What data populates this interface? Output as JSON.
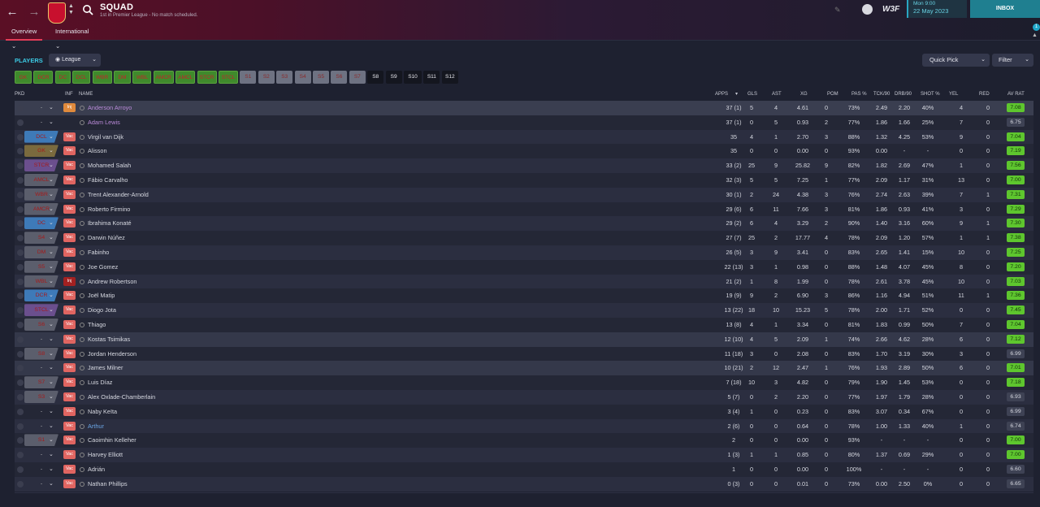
{
  "header": {
    "title": "SQUAD",
    "subtitle": "1st in Premier League - No match scheduled.",
    "tabs": [
      "Overview",
      "International"
    ],
    "date_day": "Mon 9:00",
    "date": "22 May 2023",
    "inbox": "INBOX",
    "notifications": "1",
    "brand": "W3F"
  },
  "toolbar": {
    "players": "PLAYERS",
    "league": "League",
    "quick_pick": "Quick Pick",
    "filter": "Filter"
  },
  "chips": [
    "GK",
    "DCR",
    "DC",
    "DCL",
    "WBR",
    "DM",
    "WBL",
    "AMCR",
    "AMCL",
    "STCR",
    "STCL",
    "S1",
    "S2",
    "S3",
    "S4",
    "S5",
    "S6",
    "S7",
    "S8",
    "S9",
    "S10",
    "S11",
    "S12"
  ],
  "columns": [
    "PKD",
    "INF",
    "NAME",
    "APPS",
    "GLS",
    "AST",
    "XG",
    "POM",
    "PAS %",
    "TCK/90",
    "DRB/90",
    "SHOT %",
    "YEL",
    "RED",
    "AV RAT"
  ],
  "colors": {
    "accent": "#3ccbe5",
    "inbox": "#1f7f90",
    "chip_green": "#3f8a2c",
    "rating_green": "#5ec62e",
    "vac": "#e06561",
    "inj": "#a32121",
    "tbd": "#e08a3c"
  },
  "players": [
    {
      "pos": "-",
      "inf": "Inj",
      "name": "Anderson Arroyo",
      "apps": "37 (1)",
      "gls": "5",
      "ast": "4",
      "xg": "4.61",
      "pom": "0",
      "pas": "73%",
      "tck": "2.49",
      "drb": "2.20",
      "shot": "40%",
      "yel": "4",
      "red": "0",
      "avr": "7.08",
      "name_color": "#b98ad8",
      "inf_type": "tbd"
    },
    {
      "pos": "-",
      "inf": "",
      "name": "Adam Lewis",
      "apps": "37 (1)",
      "gls": "0",
      "ast": "5",
      "xg": "0.93",
      "pom": "2",
      "pas": "77%",
      "tck": "1.86",
      "drb": "1.66",
      "shot": "25%",
      "yel": "7",
      "red": "0",
      "avr": "6.75",
      "name_color": "#b98ad8",
      "inf_type": "none"
    },
    {
      "pos": "DCL",
      "inf": "Vac",
      "name": "Virgil van Dijk",
      "apps": "35",
      "gls": "4",
      "ast": "1",
      "xg": "2.70",
      "pom": "3",
      "pas": "88%",
      "tck": "1.32",
      "drb": "4.25",
      "shot": "53%",
      "yel": "9",
      "red": "0",
      "avr": "7.04",
      "inf_type": "vac",
      "pos_color": "#3e7ab8"
    },
    {
      "pos": "GK",
      "inf": "Vac",
      "name": "Alisson",
      "apps": "35",
      "gls": "0",
      "ast": "0",
      "xg": "0.00",
      "pom": "0",
      "pas": "93%",
      "tck": "0.00",
      "drb": "-",
      "shot": "-",
      "yel": "0",
      "red": "0",
      "avr": "7.19",
      "inf_type": "vac",
      "pos_color": "#7a6a3e"
    },
    {
      "pos": "STCR",
      "inf": "Vac",
      "name": "Mohamed Salah",
      "apps": "33 (2)",
      "gls": "25",
      "ast": "9",
      "xg": "25.82",
      "pom": "9",
      "pas": "82%",
      "tck": "1.82",
      "drb": "2.69",
      "shot": "47%",
      "yel": "1",
      "red": "0",
      "avr": "7.56",
      "inf_type": "vac",
      "pos_color": "#6b4f8e"
    },
    {
      "pos": "AMCL",
      "inf": "Vac",
      "name": "Fábio Carvalho",
      "apps": "32 (3)",
      "gls": "5",
      "ast": "5",
      "xg": "7.25",
      "pom": "1",
      "pas": "77%",
      "tck": "2.09",
      "drb": "1.17",
      "shot": "31%",
      "yel": "13",
      "red": "0",
      "avr": "7.00",
      "inf_type": "vac",
      "pos_color": "#5b5e6c"
    },
    {
      "pos": "WBR",
      "inf": "Vac",
      "name": "Trent Alexander-Arnold",
      "apps": "30 (1)",
      "gls": "2",
      "ast": "24",
      "xg": "4.38",
      "pom": "3",
      "pas": "76%",
      "tck": "2.74",
      "drb": "2.63",
      "shot": "39%",
      "yel": "7",
      "red": "1",
      "avr": "7.31",
      "inf_type": "vac",
      "pos_color": "#5b5e6c"
    },
    {
      "pos": "AMCR",
      "inf": "Vac",
      "name": "Roberto Firmino",
      "apps": "29 (6)",
      "gls": "6",
      "ast": "11",
      "xg": "7.66",
      "pom": "3",
      "pas": "81%",
      "tck": "1.86",
      "drb": "0.93",
      "shot": "41%",
      "yel": "3",
      "red": "0",
      "avr": "7.29",
      "inf_type": "vac",
      "pos_color": "#5b5e6c"
    },
    {
      "pos": "DC",
      "inf": "Vac",
      "name": "Ibrahima Konaté",
      "apps": "29 (2)",
      "gls": "6",
      "ast": "4",
      "xg": "3.29",
      "pom": "2",
      "pas": "90%",
      "tck": "1.40",
      "drb": "3.16",
      "shot": "60%",
      "yel": "9",
      "red": "1",
      "avr": "7.30",
      "inf_type": "vac",
      "pos_color": "#3e7ab8"
    },
    {
      "pos": "S4",
      "inf": "Vac",
      "name": "Darwin Núñez",
      "apps": "27 (7)",
      "gls": "25",
      "ast": "2",
      "xg": "17.77",
      "pom": "4",
      "pas": "78%",
      "tck": "2.09",
      "drb": "1.20",
      "shot": "57%",
      "yel": "1",
      "red": "1",
      "avr": "7.38",
      "inf_type": "vac",
      "pos_color": "#5b5e6c"
    },
    {
      "pos": "DM",
      "inf": "Vac",
      "name": "Fabinho",
      "apps": "26 (5)",
      "gls": "3",
      "ast": "9",
      "xg": "3.41",
      "pom": "0",
      "pas": "83%",
      "tck": "2.65",
      "drb": "1.41",
      "shot": "15%",
      "yel": "10",
      "red": "0",
      "avr": "7.25",
      "inf_type": "vac",
      "pos_color": "#5b5e6c"
    },
    {
      "pos": "S5",
      "inf": "Vac",
      "name": "Joe Gomez",
      "apps": "22 (13)",
      "gls": "3",
      "ast": "1",
      "xg": "0.98",
      "pom": "0",
      "pas": "88%",
      "tck": "1.48",
      "drb": "4.07",
      "shot": "45%",
      "yel": "8",
      "red": "0",
      "avr": "7.20",
      "inf_type": "vac",
      "pos_color": "#5b5e6c"
    },
    {
      "pos": "WBL",
      "inf": "Inj",
      "name": "Andrew Robertson",
      "apps": "21 (2)",
      "gls": "1",
      "ast": "8",
      "xg": "1.99",
      "pom": "0",
      "pas": "78%",
      "tck": "2.61",
      "drb": "3.78",
      "shot": "45%",
      "yel": "10",
      "red": "0",
      "avr": "7.03",
      "inf_type": "inj",
      "pos_color": "#5b5e6c"
    },
    {
      "pos": "DCR",
      "inf": "Vac",
      "name": "Joël Matip",
      "apps": "19 (9)",
      "gls": "9",
      "ast": "2",
      "xg": "6.90",
      "pom": "3",
      "pas": "86%",
      "tck": "1.16",
      "drb": "4.94",
      "shot": "51%",
      "yel": "11",
      "red": "1",
      "avr": "7.36",
      "inf_type": "vac",
      "pos_color": "#3e7ab8"
    },
    {
      "pos": "STCL",
      "inf": "Vac",
      "name": "Diogo Jota",
      "apps": "13 (22)",
      "gls": "18",
      "ast": "10",
      "xg": "15.23",
      "pom": "5",
      "pas": "78%",
      "tck": "2.00",
      "drb": "1.71",
      "shot": "52%",
      "yel": "0",
      "red": "0",
      "avr": "7.45",
      "inf_type": "vac",
      "pos_color": "#6b4f8e"
    },
    {
      "pos": "S6",
      "inf": "Vac",
      "name": "Thiago",
      "apps": "13 (8)",
      "gls": "4",
      "ast": "1",
      "xg": "3.34",
      "pom": "0",
      "pas": "81%",
      "tck": "1.83",
      "drb": "0.99",
      "shot": "50%",
      "yel": "7",
      "red": "0",
      "avr": "7.04",
      "inf_type": "vac",
      "pos_color": "#5b5e6c"
    },
    {
      "pos": "-",
      "inf": "Vac",
      "name": "Kostas Tsimikas",
      "apps": "12 (10)",
      "gls": "4",
      "ast": "5",
      "xg": "2.09",
      "pom": "1",
      "pas": "74%",
      "tck": "2.66",
      "drb": "4.62",
      "shot": "28%",
      "yel": "6",
      "red": "0",
      "avr": "7.12",
      "inf_type": "vac",
      "pos_color": "#5b5e6c"
    },
    {
      "pos": "S8",
      "inf": "Vac",
      "name": "Jordan Henderson",
      "apps": "11 (18)",
      "gls": "3",
      "ast": "0",
      "xg": "2.08",
      "pom": "0",
      "pas": "83%",
      "tck": "1.70",
      "drb": "3.19",
      "shot": "30%",
      "yel": "3",
      "red": "0",
      "avr": "6.99",
      "inf_type": "vac",
      "pos_color": "#5b5e6c"
    },
    {
      "pos": "-",
      "inf": "Vac",
      "name": "James Milner",
      "apps": "10 (21)",
      "gls": "2",
      "ast": "12",
      "xg": "2.47",
      "pom": "1",
      "pas": "76%",
      "tck": "1.93",
      "drb": "2.89",
      "shot": "50%",
      "yel": "6",
      "red": "0",
      "avr": "7.01",
      "inf_type": "vac",
      "pos_color": "#5b5e6c"
    },
    {
      "pos": "S7",
      "inf": "Vac",
      "name": "Luis Díaz",
      "apps": "7 (18)",
      "gls": "10",
      "ast": "3",
      "xg": "4.82",
      "pom": "0",
      "pas": "79%",
      "tck": "1.90",
      "drb": "1.45",
      "shot": "53%",
      "yel": "0",
      "red": "0",
      "avr": "7.18",
      "inf_type": "vac",
      "pos_color": "#5b5e6c"
    },
    {
      "pos": "S3",
      "inf": "Vac",
      "name": "Alex Oxlade-Chamberlain",
      "apps": "5 (7)",
      "gls": "0",
      "ast": "2",
      "xg": "2.20",
      "pom": "0",
      "pas": "77%",
      "tck": "1.97",
      "drb": "1.79",
      "shot": "28%",
      "yel": "0",
      "red": "0",
      "avr": "6.93",
      "inf_type": "vac",
      "pos_color": "#5b5e6c"
    },
    {
      "pos": "-",
      "inf": "Vac",
      "name": "Naby Keïta",
      "apps": "3 (4)",
      "gls": "1",
      "ast": "0",
      "xg": "0.23",
      "pom": "0",
      "pas": "83%",
      "tck": "3.07",
      "drb": "0.34",
      "shot": "67%",
      "yel": "0",
      "red": "0",
      "avr": "6.99",
      "inf_type": "vac",
      "pos_color": "#5b5e6c"
    },
    {
      "pos": "-",
      "inf": "Vac",
      "name": "Arthur",
      "apps": "2 (6)",
      "gls": "0",
      "ast": "0",
      "xg": "0.64",
      "pom": "0",
      "pas": "78%",
      "tck": "1.00",
      "drb": "1.33",
      "shot": "40%",
      "yel": "1",
      "red": "0",
      "avr": "6.74",
      "inf_type": "vac",
      "pos_color": "#5b5e6c",
      "name_color": "#6ba6e6"
    },
    {
      "pos": "S1",
      "inf": "Vac",
      "name": "Caoimhin Kelleher",
      "apps": "2",
      "gls": "0",
      "ast": "0",
      "xg": "0.00",
      "pom": "0",
      "pas": "93%",
      "tck": "-",
      "drb": "-",
      "shot": "-",
      "yel": "0",
      "red": "0",
      "avr": "7.00",
      "inf_type": "vac",
      "pos_color": "#5b5e6c"
    },
    {
      "pos": "-",
      "inf": "Vac",
      "name": "Harvey Elliott",
      "apps": "1 (3)",
      "gls": "1",
      "ast": "1",
      "xg": "0.85",
      "pom": "0",
      "pas": "80%",
      "tck": "1.37",
      "drb": "0.69",
      "shot": "29%",
      "yel": "0",
      "red": "0",
      "avr": "7.00",
      "inf_type": "vac",
      "pos_color": "#5b5e6c"
    },
    {
      "pos": "-",
      "inf": "Vac",
      "name": "Adrián",
      "apps": "1",
      "gls": "0",
      "ast": "0",
      "xg": "0.00",
      "pom": "0",
      "pas": "100%",
      "tck": "-",
      "drb": "-",
      "shot": "-",
      "yel": "0",
      "red": "0",
      "avr": "6.60",
      "inf_type": "vac",
      "pos_color": "#5b5e6c"
    },
    {
      "pos": "-",
      "inf": "Vac",
      "name": "Nathan Phillips",
      "apps": "0 (3)",
      "gls": "0",
      "ast": "0",
      "xg": "0.01",
      "pom": "0",
      "pas": "73%",
      "tck": "0.00",
      "drb": "2.50",
      "shot": "0%",
      "yel": "0",
      "red": "0",
      "avr": "6.65",
      "inf_type": "vac",
      "pos_color": "#5b5e6c"
    }
  ]
}
